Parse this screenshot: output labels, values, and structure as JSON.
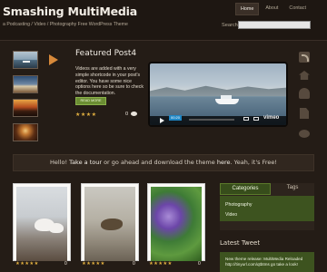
{
  "header": {
    "site_title": "Smashing MultiMedia",
    "tagline": "a Podcasting / Video / Photography Free WordPress Theme",
    "nav": [
      "Home",
      "About",
      "Contact"
    ],
    "active_nav": "Home",
    "search_label": "Search:",
    "search_placeholder": ""
  },
  "featured": {
    "title": "Featured Post4",
    "description": "Videos are added with a very simple shortcode in your post's editor. You have some nice options here so be sure to check the documentation.",
    "read_more": "READ MORE",
    "stars": "★★★★",
    "comment_count": "0",
    "video_time": "00:20",
    "video_brand": "vimeo"
  },
  "social_icons": [
    "rss-icon",
    "home-icon",
    "user-icon",
    "document-icon",
    "chat-icon"
  ],
  "welcome": {
    "prefix": "Hello! ",
    "link1": "Take a tour",
    "middle": " or go ahead and download the theme ",
    "link2": "here",
    "suffix": ". Yeah, it's Free!"
  },
  "posts": [
    {
      "stars": "★★★★★",
      "comments": "0"
    },
    {
      "stars": "★★★★★",
      "comments": "0"
    },
    {
      "stars": "★★★★★",
      "comments": "0"
    }
  ],
  "sidebar": {
    "tabs": [
      "Categories",
      "Tags"
    ],
    "active_tab": "Categories",
    "categories": [
      "Photography",
      "Video"
    ],
    "latest_tweet_title": "Latest Tweet",
    "tweet": "New theme release: MultiMedia Reloaded http://tinyurl.com/qtbtms go take a look!"
  },
  "colors": {
    "background": "#241c16",
    "accent_green": "#3d531f",
    "star_gold": "#e2b040",
    "arrow_orange": "#d7893a"
  }
}
